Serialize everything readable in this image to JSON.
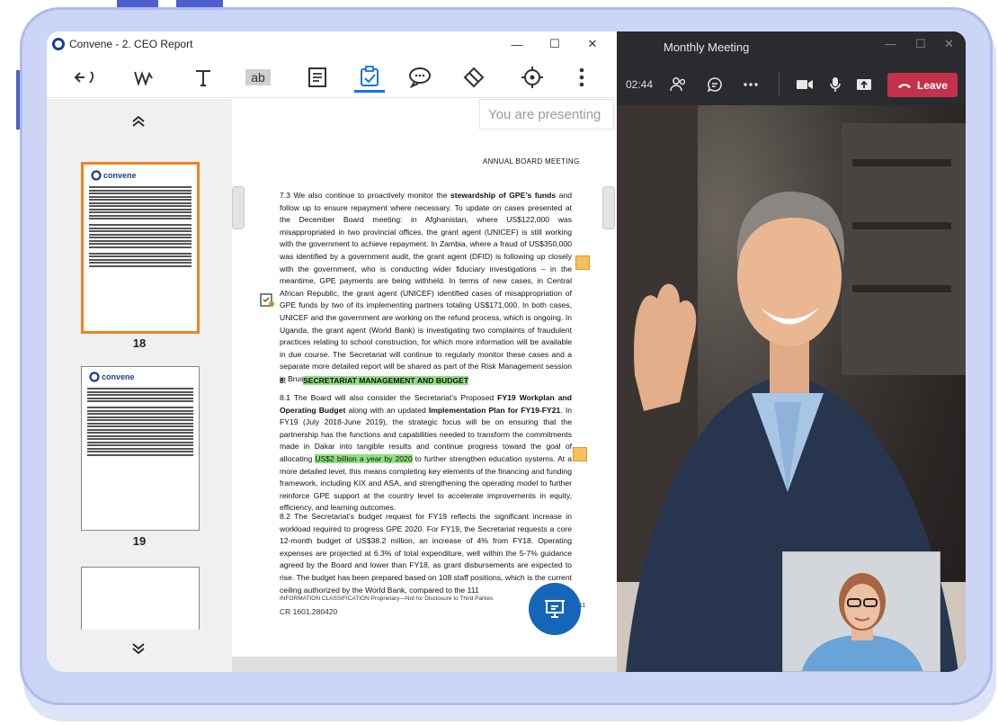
{
  "app": {
    "title": "Convene - 2. CEO Report",
    "window_controls": [
      "—",
      "☐",
      "✕"
    ],
    "toolbar_icons": [
      "undo-redo-icon",
      "ink-pen-icon",
      "text-tool-icon",
      "text-box-icon",
      "notes-icon",
      "task-check-icon",
      "comment-icon",
      "eraser-icon",
      "target-icon",
      "more-icon"
    ],
    "active_tool": "task-check-icon"
  },
  "thumbnails": {
    "pages": [
      {
        "number": "18",
        "selected": true,
        "brand": "convene"
      },
      {
        "number": "19",
        "selected": false,
        "brand": "convene"
      }
    ]
  },
  "document": {
    "presenting_label": "You are presenting",
    "header": "ANNUAL BOARD MEETING",
    "p73": {
      "a": "7.3 We also continue to proactively monitor the ",
      "b": "stewardship of GPE’s funds",
      "c": " and follow up to ensure repayment where necessary. To update on cases presented at the December Board meeting: in Afghanistan, where US$122,000 was misappropriated in two provincial offices, the grant agent (UNICEF) is still working with the government to achieve repayment. In Zambia, where a fraud of US$350,000 was identified by a government audit, the grant agent (DFID) is following up closely with the government, who is conducting wider fiduciary investigations – in the meantime, GPE payments are being withheld. In terms of new cases, in Central African Republic, the grant agent (UNICEF) identified cases of misappropriation of GPE funds by two of its implementing partners totaling US$171,000. In both cases, UNICEF and the government are working on the refund process, which is ongoing. In Uganda, the grant agent (World Bank) is investigating two complaints of fraudulent practices relating to school construction, for which more information will be available in due course. The Secretariat will continue to regularly monitor these cases and a separate more detailed report will be shared as part of the Risk Management session in Brussels."
    },
    "section_number": "8.",
    "section_title": "SECRETARIAT MANAGEMENT AND BUDGET",
    "p81": {
      "a": "8.1 The Board will also consider the Secretariat’s Proposed ",
      "b": "FY19 Workplan and Operating Budget",
      "c": " along with an updated ",
      "d": "Implementation Plan for FY19-FY21",
      "e": ". In FY19 (July 2018-June 2019), the strategic focus will be on ensuring that the partnership has the functions and capabilities needed to transform the commitments made in Dakar into tangible results and continue progress toward the goal of allocating ",
      "hl": "US$2 billion a year by 2020",
      "f": " to further strengthen education systems. At a more detailed level, this means completing key elements of the financing and funding framework, including KIX and ASA, and strengthening the operating model to further reinforce GPE support at the country level to accelerate improvements in equity, efficiency, and learning outcomes."
    },
    "p82": "8.2 The Secretariat’s budget request for FY19 reflects the significant increase in workload required to progress GPE 2020. For FY19, the Secretariat requests a core 12-month budget of US$38.2 million, an increase of 4% from FY18. Operating expenses are projected at 6.3% of total expenditure, well within the 5-7% guidance agreed by the Board and lower than FY18, as grant disbursements are expected to rise. The budget has been prepared based on 108 staff positions, which is the current ceiling authorized by the World Bank, compared to the 111",
    "footer_classification": "INFORMATION CLASSIFICATION Proprietary—Not for Disclosure to Third Parties",
    "footer_ref": "CR 1601.280420",
    "page_number": "11"
  },
  "meeting": {
    "title": "Monthly Meeting",
    "window_controls": [
      "—",
      "☐",
      "✕"
    ],
    "timer": "02:44",
    "leave_label": "Leave",
    "colors": {
      "leave": "#c4314b",
      "bar": "#2b2b2f"
    }
  },
  "colors": {
    "accent": "#1776d2",
    "selection": "#f08322",
    "highlight": "#8ee07e",
    "fab": "#1566b8"
  }
}
